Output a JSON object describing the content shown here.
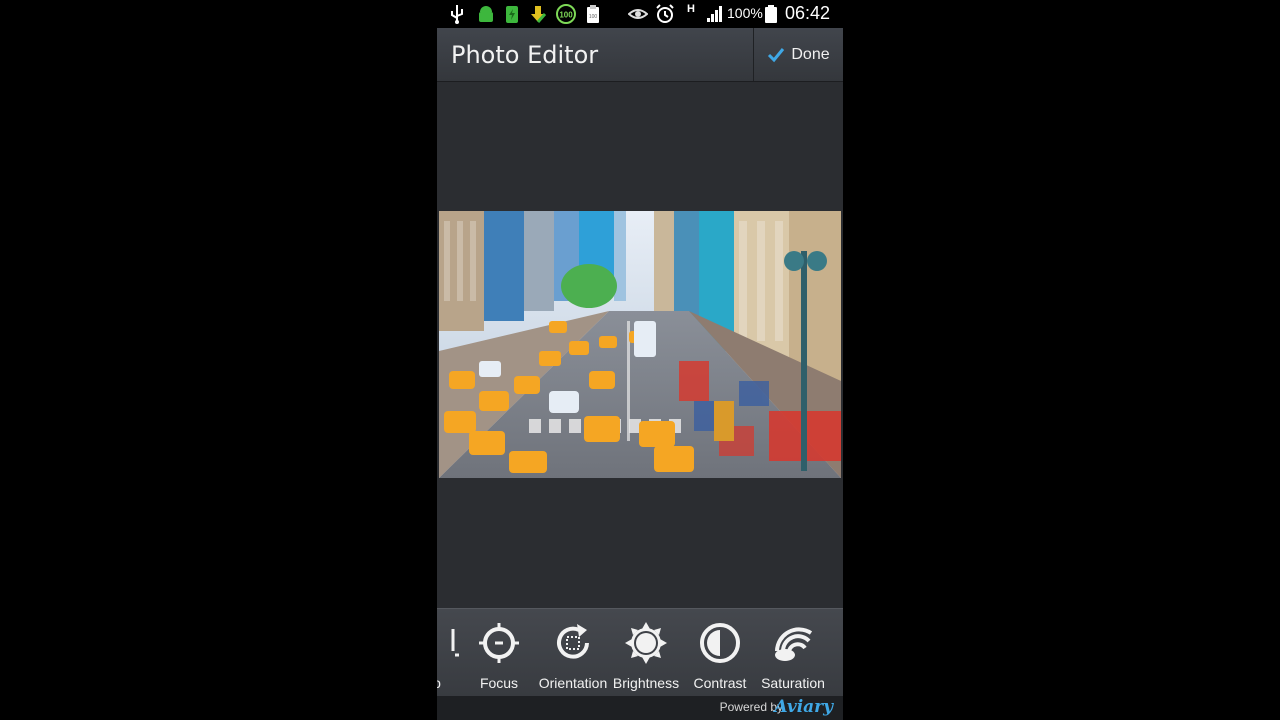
{
  "status_bar": {
    "battery_percent": "100%",
    "time": "06:42",
    "network_label": "H",
    "icons": [
      "usb-icon",
      "android-icon",
      "battery-charge-icon",
      "download-icon",
      "100-badge-icon",
      "clipboard-icon",
      "eye-icon",
      "alarm-icon",
      "network-icon",
      "signal-icon",
      "battery-icon"
    ]
  },
  "action_bar": {
    "title": "Photo Editor",
    "done_label": "Done"
  },
  "tools": [
    {
      "label": "Focus",
      "icon": "focus-icon"
    },
    {
      "label": "Orientation",
      "icon": "orientation-icon"
    },
    {
      "label": "Brightness",
      "icon": "brightness-icon"
    },
    {
      "label": "Contrast",
      "icon": "contrast-icon"
    },
    {
      "label": "Saturation",
      "icon": "saturation-icon"
    }
  ],
  "partial_tool_label": "o",
  "footer": {
    "powered_by": "Powered by",
    "brand": "Aviary"
  },
  "colors": {
    "accent": "#3fa8e6",
    "toolbar": "#3e4147",
    "canvas": "#2b2d31"
  }
}
